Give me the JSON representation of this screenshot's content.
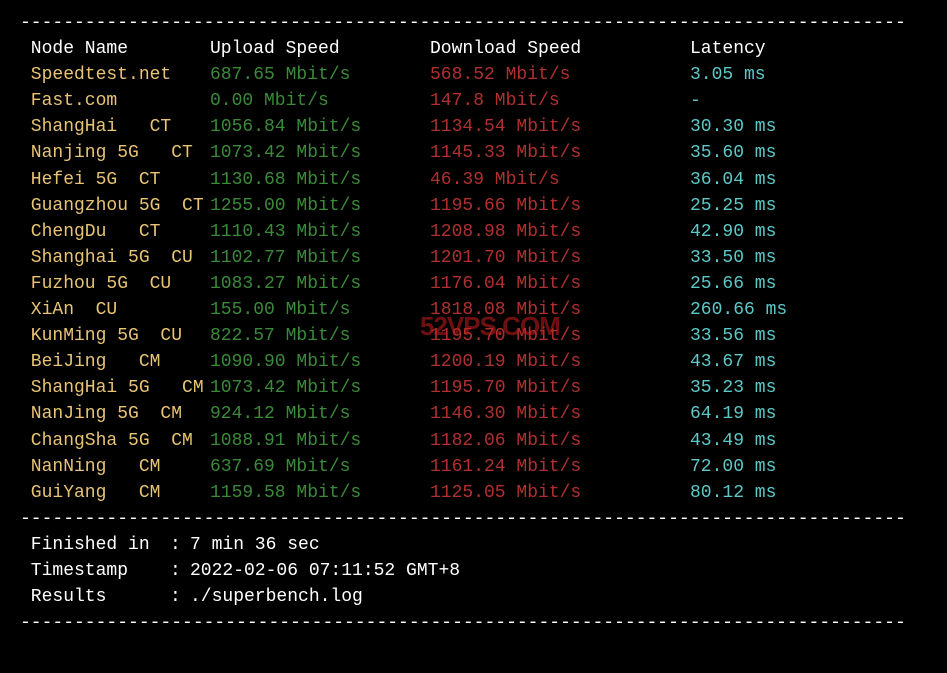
{
  "divider": "----------------------------------------------------------------------------------",
  "header": {
    "node": " Node Name",
    "upload": "Upload Speed",
    "download": "Download Speed",
    "latency": "Latency"
  },
  "rows": [
    {
      "node": " Speedtest.net",
      "upload": "687.65 Mbit/s",
      "download": "568.52 Mbit/s",
      "latency": "3.05 ms"
    },
    {
      "node": " Fast.com",
      "upload": "0.00 Mbit/s",
      "download": "147.8 Mbit/s",
      "latency": "-"
    },
    {
      "node": " ShangHai   CT",
      "upload": "1056.84 Mbit/s",
      "download": "1134.54 Mbit/s",
      "latency": "30.30 ms"
    },
    {
      "node": " Nanjing 5G   CT",
      "upload": "1073.42 Mbit/s",
      "download": "1145.33 Mbit/s",
      "latency": "35.60 ms"
    },
    {
      "node": " Hefei 5G  CT",
      "upload": "1130.68 Mbit/s",
      "download": "46.39 Mbit/s",
      "latency": "36.04 ms"
    },
    {
      "node": " Guangzhou 5G  CT",
      "upload": "1255.00 Mbit/s",
      "download": "1195.66 Mbit/s",
      "latency": "25.25 ms"
    },
    {
      "node": " ChengDu   CT",
      "upload": "1110.43 Mbit/s",
      "download": "1208.98 Mbit/s",
      "latency": "42.90 ms"
    },
    {
      "node": " Shanghai 5G  CU",
      "upload": "1102.77 Mbit/s",
      "download": "1201.70 Mbit/s",
      "latency": "33.50 ms"
    },
    {
      "node": " Fuzhou 5G  CU",
      "upload": "1083.27 Mbit/s",
      "download": "1176.04 Mbit/s",
      "latency": "25.66 ms"
    },
    {
      "node": " XiAn  CU",
      "upload": "155.00 Mbit/s",
      "download": "1818.08 Mbit/s",
      "latency": "260.66 ms"
    },
    {
      "node": " KunMing 5G  CU",
      "upload": "822.57 Mbit/s",
      "download": "1195.70 Mbit/s",
      "latency": "33.56 ms"
    },
    {
      "node": " BeiJing   CM",
      "upload": "1090.90 Mbit/s",
      "download": "1200.19 Mbit/s",
      "latency": "43.67 ms"
    },
    {
      "node": " ShangHai 5G   CM",
      "upload": "1073.42 Mbit/s",
      "download": "1195.70 Mbit/s",
      "latency": "35.23 ms"
    },
    {
      "node": " NanJing 5G  CM",
      "upload": "924.12 Mbit/s",
      "download": "1146.30 Mbit/s",
      "latency": "64.19 ms"
    },
    {
      "node": " ChangSha 5G  CM",
      "upload": "1088.91 Mbit/s",
      "download": "1182.06 Mbit/s",
      "latency": "43.49 ms"
    },
    {
      "node": " NanNing   CM",
      "upload": "637.69 Mbit/s",
      "download": "1161.24 Mbit/s",
      "latency": "72.00 ms"
    },
    {
      "node": " GuiYang   CM",
      "upload": "1159.58 Mbit/s",
      "download": "1125.05 Mbit/s",
      "latency": "80.12 ms"
    }
  ],
  "footer": {
    "finished_label": " Finished in",
    "finished_value": "7 min 36 sec",
    "timestamp_label": " Timestamp",
    "timestamp_value": "2022-02-06 07:11:52 GMT+8",
    "results_label": " Results",
    "results_value": "./superbench.log"
  },
  "watermark": "52VPS.COM"
}
